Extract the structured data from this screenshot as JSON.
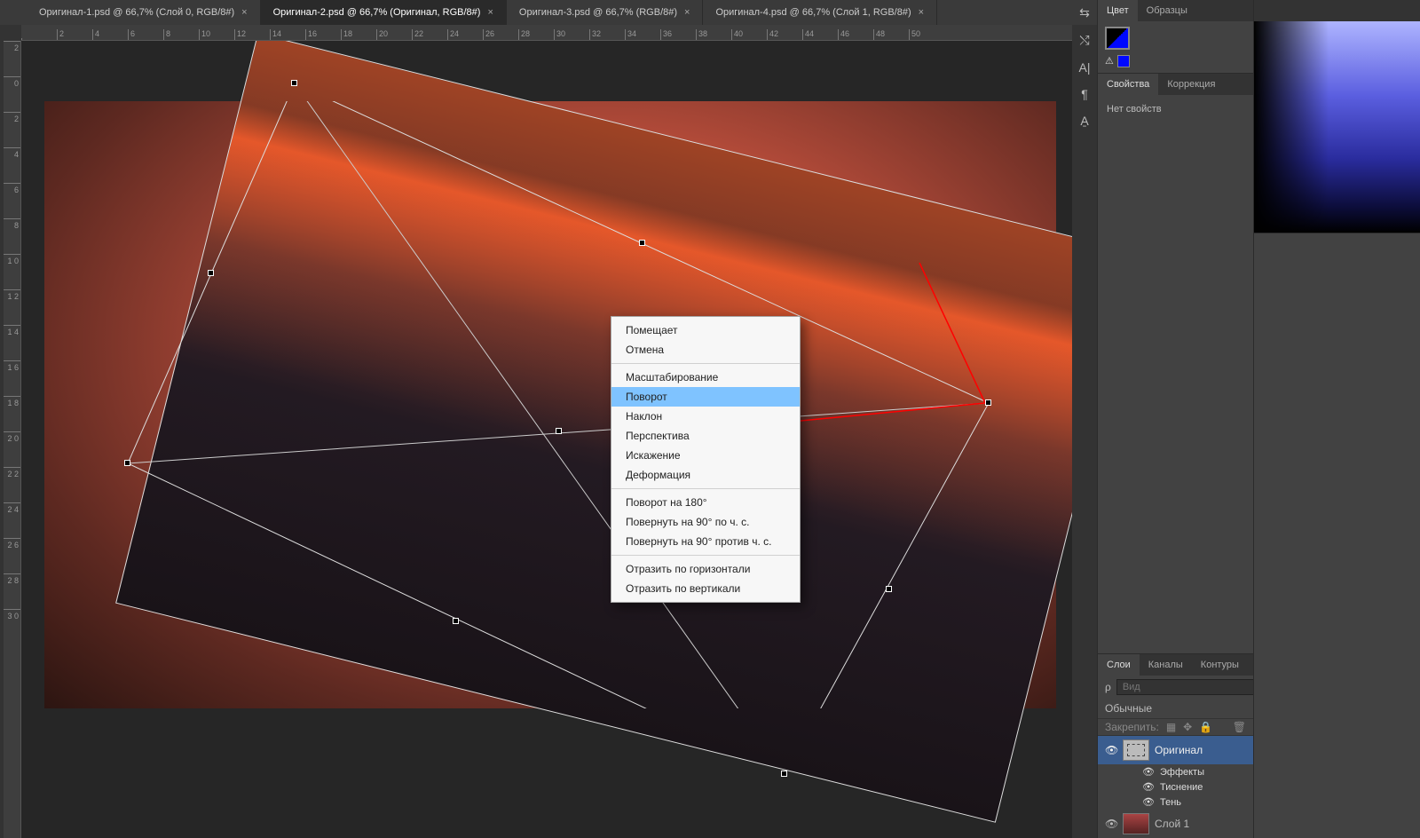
{
  "tabs": [
    {
      "label": "Оригинал-1.psd @ 66,7% (Слой 0, RGB/8#)",
      "active": false
    },
    {
      "label": "Оригинал-2.psd @ 66,7% (Оригинал, RGB/8#)",
      "active": true
    },
    {
      "label": "Оригинал-3.psd @ 66,7% (RGB/8#)",
      "active": false
    },
    {
      "label": "Оригинал-4.psd @ 66,7% (Слой 1, RGB/8#)",
      "active": false
    }
  ],
  "ruler_h": [
    "",
    "2",
    "4",
    "6",
    "8",
    "10",
    "12",
    "14",
    "16",
    "18",
    "20",
    "22",
    "24",
    "26",
    "28",
    "30",
    "32",
    "34",
    "36",
    "38",
    "40",
    "42",
    "44",
    "46",
    "48",
    "50"
  ],
  "ruler_v": [
    "2",
    "0",
    "2",
    "4",
    "6",
    "8",
    "1\n0",
    "1\n2",
    "1\n4",
    "1\n6",
    "1\n8",
    "2\n0",
    "2\n2",
    "2\n4",
    "2\n6",
    "2\n8",
    "3\n0"
  ],
  "context_menu": {
    "group1": [
      "Помещает",
      "Отмена"
    ],
    "group2": [
      "Масштабирование",
      "Поворот",
      "Наклон",
      "Перспектива",
      "Искажение",
      "Деформация"
    ],
    "highlight": "Поворот",
    "group3": [
      "Поворот на 180°",
      "Повернуть на 90° по ч. с.",
      "Повернуть на 90° против ч. с."
    ],
    "group4": [
      "Отразить по горизонтали",
      "Отразить по вертикали"
    ]
  },
  "tool_icons": [
    "toggles-icon",
    "swap-icon",
    "A-icon",
    "paragraph-icon",
    "style-icon"
  ],
  "tool_glyphs": [
    "⇆",
    "⤭",
    "A|",
    "¶",
    "A̱"
  ],
  "color_tab1": "Цвет",
  "color_tab2": "Образцы",
  "props_tab1": "Свойства",
  "props_tab2": "Коррекция",
  "no_props": "Нет свойств",
  "layers_tab1": "Слои",
  "layers_tab2": "Каналы",
  "layers_tab3": "Контуры",
  "filter_prefix": "ρ",
  "filter_placeholder": "Вид",
  "blend_mode": "Обычные",
  "lock_label": "Закрепить:",
  "layer1": "Оригинал",
  "fx_label": "Эффекты",
  "fx_emboss": "Тиснение",
  "fx_shadow": "Тень",
  "layer2": "Слой 1"
}
